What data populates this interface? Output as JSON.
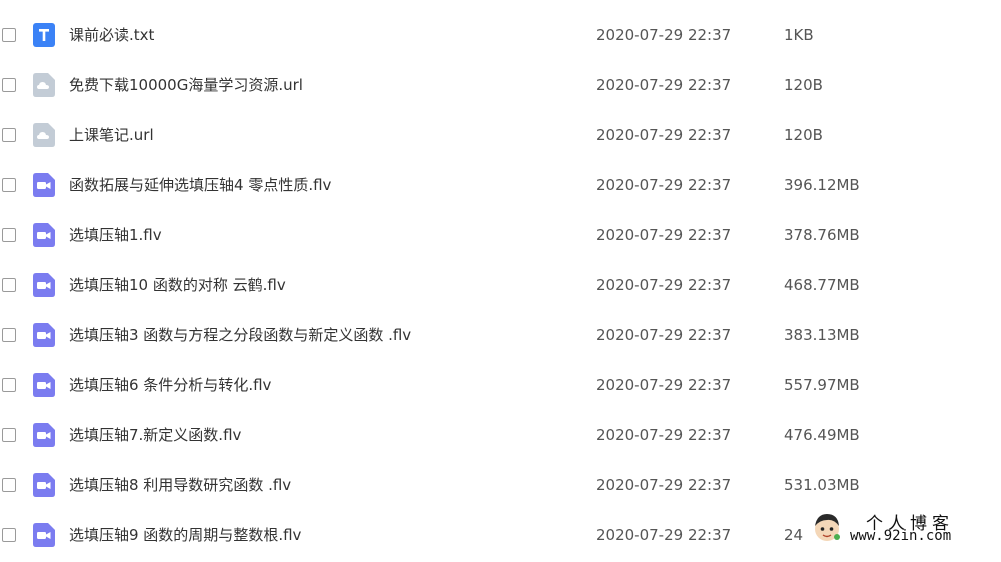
{
  "files": [
    {
      "name": "课前必读.txt",
      "date": "2020-07-29 22:37",
      "size": "1KB",
      "icon": "text-file-icon"
    },
    {
      "name": "免费下载10000G海量学习资源.url",
      "date": "2020-07-29 22:37",
      "size": "120B",
      "icon": "link-file-icon"
    },
    {
      "name": "上课笔记.url",
      "date": "2020-07-29 22:37",
      "size": "120B",
      "icon": "link-file-icon"
    },
    {
      "name": "函数拓展与延伸选填压轴4 零点性质.flv",
      "date": "2020-07-29 22:37",
      "size": "396.12MB",
      "icon": "video-file-icon"
    },
    {
      "name": "选填压轴1.flv",
      "date": "2020-07-29 22:37",
      "size": "378.76MB",
      "icon": "video-file-icon"
    },
    {
      "name": "选填压轴10 函数的对称 云鹤.flv",
      "date": "2020-07-29 22:37",
      "size": "468.77MB",
      "icon": "video-file-icon"
    },
    {
      "name": "选填压轴3 函数与方程之分段函数与新定义函数 .flv",
      "date": "2020-07-29 22:37",
      "size": "383.13MB",
      "icon": "video-file-icon"
    },
    {
      "name": "选填压轴6 条件分析与转化.flv",
      "date": "2020-07-29 22:37",
      "size": "557.97MB",
      "icon": "video-file-icon"
    },
    {
      "name": "选填压轴7.新定义函数.flv",
      "date": "2020-07-29 22:37",
      "size": "476.49MB",
      "icon": "video-file-icon"
    },
    {
      "name": "选填压轴8 利用导数研究函数 .flv",
      "date": "2020-07-29 22:37",
      "size": "531.03MB",
      "icon": "video-file-icon"
    },
    {
      "name": "选填压轴9 函数的周期与整数根.flv",
      "date": "2020-07-29 22:37",
      "size": "24",
      "icon": "video-file-icon"
    }
  ],
  "watermark": {
    "title": "个人博客",
    "url": "www.92in.com"
  },
  "colors": {
    "text_icon": "#3b82f6",
    "link_icon": "#c3ccd6",
    "video_icon": "#7b7cf0"
  }
}
